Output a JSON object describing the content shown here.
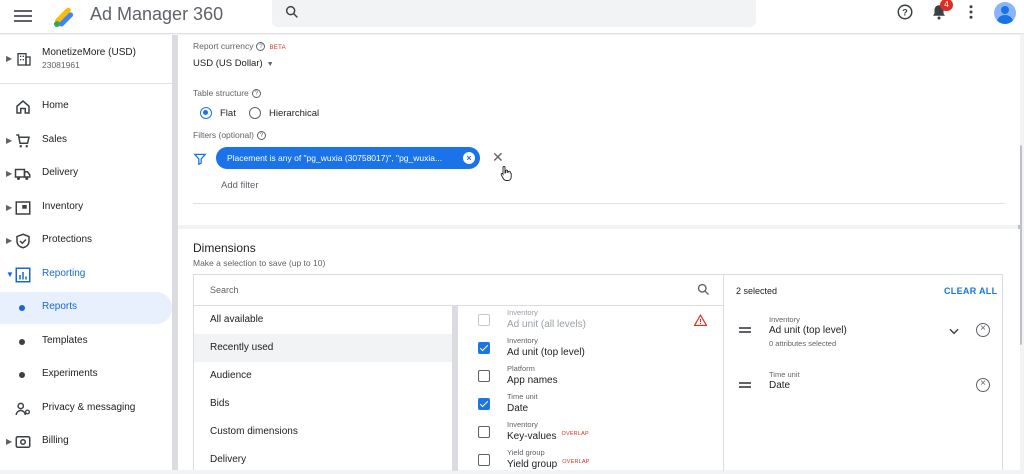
{
  "app": {
    "title": "Ad Manager 360",
    "notifications": "4"
  },
  "network": {
    "name": "MonetizeMore (USD)",
    "id": "23081961"
  },
  "nav": [
    {
      "label": "Home"
    },
    {
      "label": "Sales"
    },
    {
      "label": "Delivery"
    },
    {
      "label": "Inventory"
    },
    {
      "label": "Protections"
    },
    {
      "label": "Reporting"
    },
    {
      "label": "Reports"
    },
    {
      "label": "Templates"
    },
    {
      "label": "Experiments"
    },
    {
      "label": "Privacy & messaging"
    },
    {
      "label": "Billing"
    }
  ],
  "settings": {
    "currency_label": "Report currency",
    "beta": "BETA",
    "currency_value": "USD (US Dollar)",
    "table_label": "Table structure",
    "flat": "Flat",
    "hierarchical": "Hierarchical",
    "filters_label": "Filters (optional)",
    "filter_chip": "Placement is any of \"pg_wuxia (30758017)\", \"pg_wuxia...",
    "add_filter": "Add filter"
  },
  "dimensions": {
    "title": "Dimensions",
    "subtitle": "Make a selection to save (up to 10)",
    "search_placeholder": "Search",
    "categories": [
      "All available",
      "Recently used",
      "Audience",
      "Bids",
      "Custom dimensions",
      "Delivery"
    ],
    "options": [
      {
        "category": "Inventory",
        "name": "Ad unit (all levels)",
        "state": "disabled",
        "tag": ""
      },
      {
        "category": "Inventory",
        "name": "Ad unit (top level)",
        "state": "checked",
        "tag": ""
      },
      {
        "category": "Platform",
        "name": "App names",
        "state": "unchecked",
        "tag": ""
      },
      {
        "category": "Time unit",
        "name": "Date",
        "state": "checked",
        "tag": ""
      },
      {
        "category": "Inventory",
        "name": "Key-values",
        "state": "unchecked",
        "tag": "OVERLAP"
      },
      {
        "category": "Yield group",
        "name": "Yield group",
        "state": "unchecked",
        "tag": "OVERLAP"
      }
    ],
    "selected_count": "2 selected",
    "clear_all": "CLEAR ALL",
    "selected": [
      {
        "category": "Inventory",
        "name": "Ad unit (top level)",
        "attributes": "0 attributes selected"
      },
      {
        "category": "Time unit",
        "name": "Date"
      }
    ]
  },
  "colors": {
    "accent": "#1a73e8",
    "warning": "#d93025"
  }
}
